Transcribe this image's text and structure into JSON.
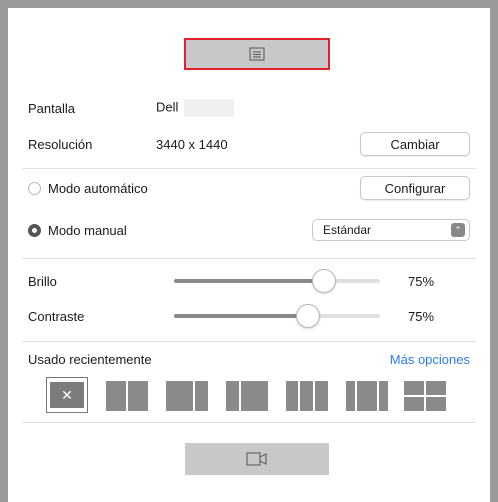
{
  "display": {
    "label": "Pantalla",
    "value": "Dell"
  },
  "resolution": {
    "label": "Resolución",
    "value": "3440 x 1440",
    "button": "Cambiar"
  },
  "auto_mode": {
    "label": "Modo automático",
    "button": "Configurar",
    "checked": false
  },
  "manual_mode": {
    "label": "Modo manual",
    "checked": true,
    "preset": "Estándar"
  },
  "brightness": {
    "label": "Brillo",
    "value_text": "75%",
    "value": 75
  },
  "contrast": {
    "label": "Contraste",
    "value_text": "75%",
    "value": 75
  },
  "recent": {
    "label": "Usado recientemente",
    "more": "Más opciones"
  },
  "icons": {
    "top": "list-document-icon",
    "bottom": "video-camera-icon",
    "clear": "close-icon"
  },
  "colors": {
    "accent": "#2b7de9",
    "highlight": "#e0202a"
  }
}
